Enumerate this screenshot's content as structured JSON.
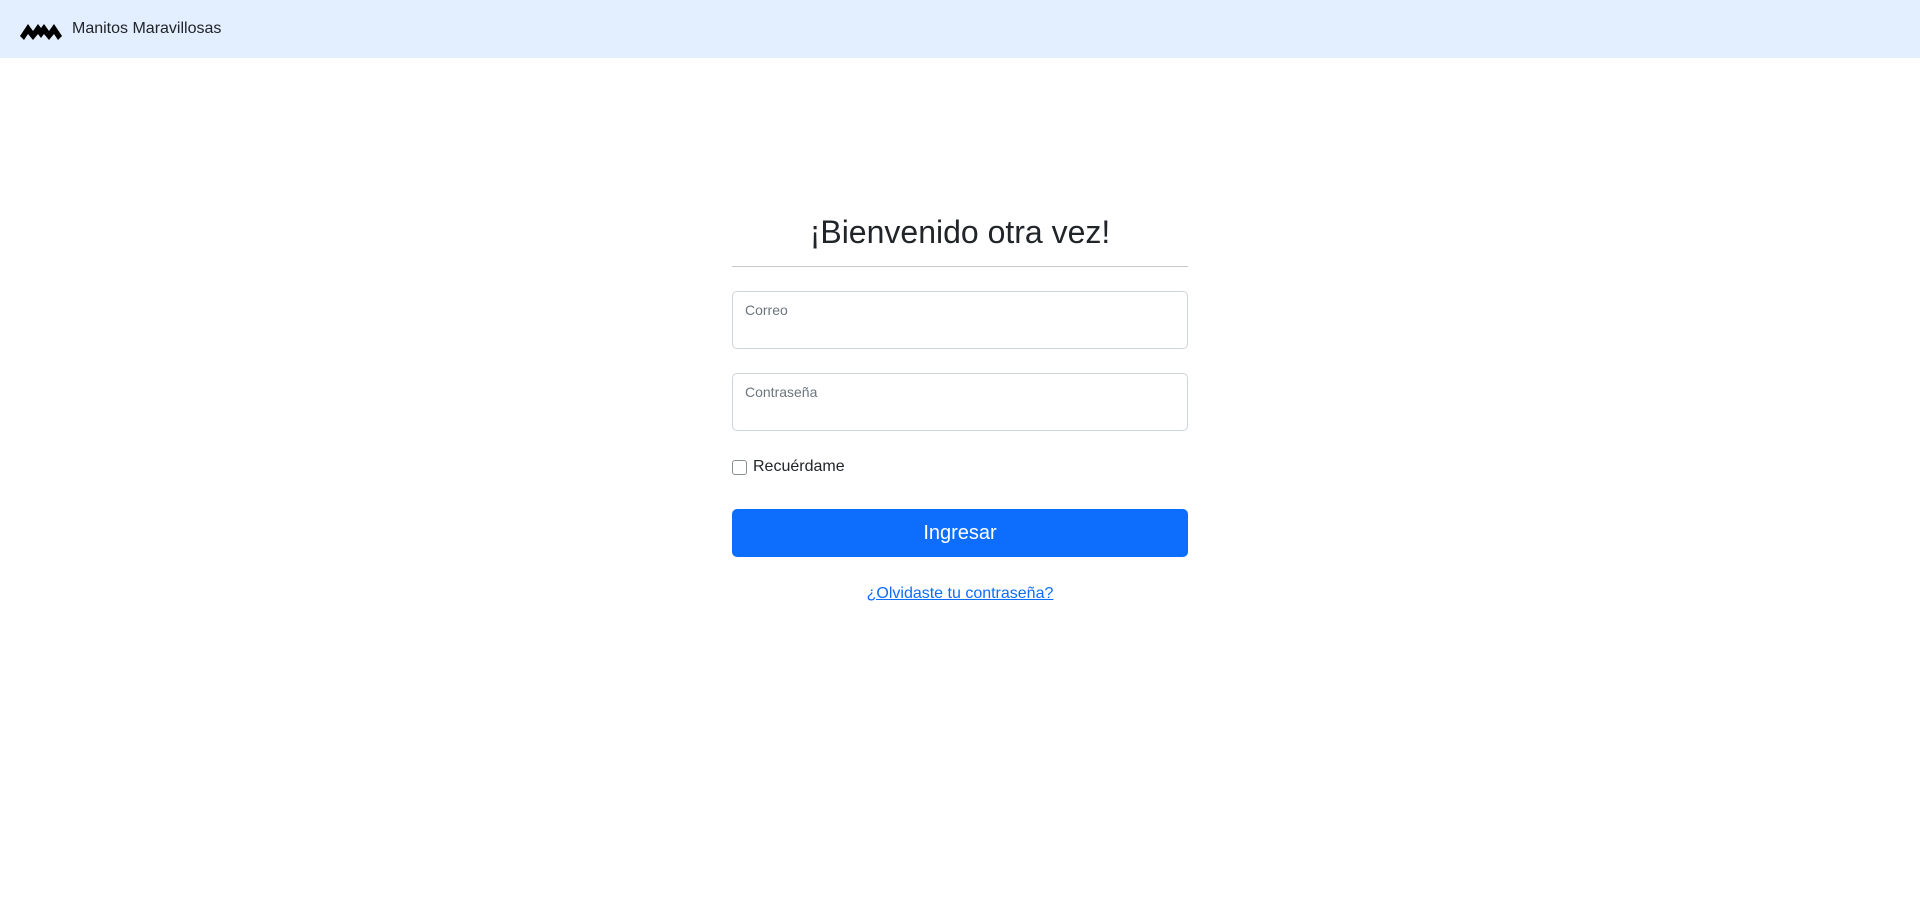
{
  "navbar": {
    "brand_name": "Manitos Maravillosas",
    "logo_icon": "mm-logo-icon",
    "background": "#e3eefe"
  },
  "login": {
    "title": "¡Bienvenido otra vez!",
    "email": {
      "label": "Correo",
      "value": ""
    },
    "password": {
      "label": "Contraseña",
      "value": ""
    },
    "remember": {
      "label": "Recuérdame",
      "checked": false
    },
    "submit_label": "Ingresar",
    "forgot_label": "¿Olvidaste tu contraseña?"
  },
  "colors": {
    "primary": "#0d6efd",
    "text": "#212529",
    "muted": "#6c757d"
  }
}
